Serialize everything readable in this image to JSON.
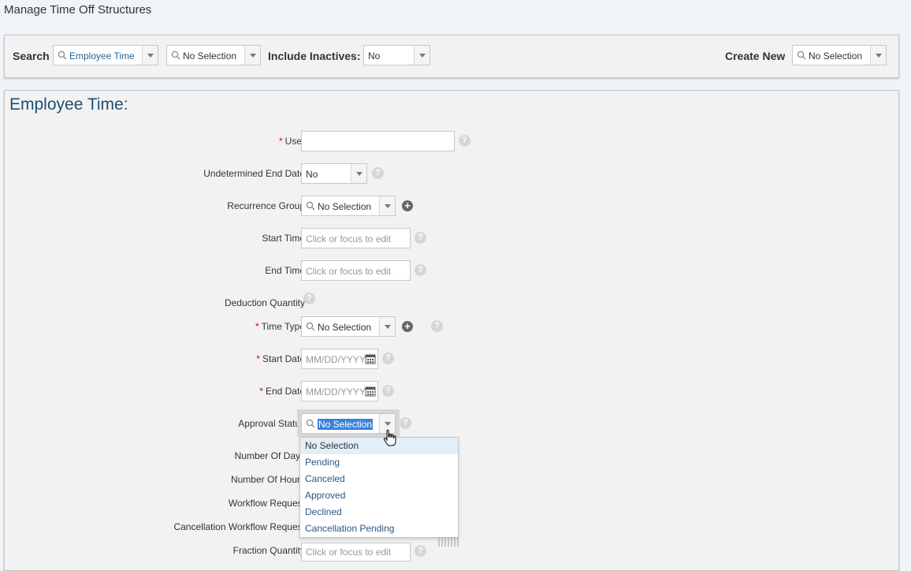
{
  "page": {
    "title": "Manage Time Off Structures"
  },
  "toolbar": {
    "search_label": "Search",
    "search_type": "Employee Time",
    "search_value": "No Selection",
    "include_inactives_label": "Include Inactives:",
    "include_inactives_value": "No",
    "create_new_label": "Create New",
    "create_new_value": "No Selection"
  },
  "form": {
    "title": "Employee Time:",
    "user_label": "User",
    "undetermined_end_date_label": "Undetermined End Date",
    "undetermined_end_date_value": "No",
    "recurrence_group_label": "Recurrence Group",
    "recurrence_group_value": "No Selection",
    "start_time_label": "Start Time",
    "start_time_placeholder": "Click or focus to edit",
    "end_time_label": "End Time",
    "end_time_placeholder": "Click or focus to edit",
    "deduction_quantity_label": "Deduction Quantity",
    "time_type_label": "Time Type",
    "time_type_value": "No Selection",
    "start_date_label": "Start Date",
    "start_date_placeholder": "MM/DD/YYYY",
    "end_date_label": "End Date",
    "end_date_placeholder": "MM/DD/YYYY",
    "approval_status_label": "Approval Status",
    "approval_status_value": "No Selection",
    "number_of_days_label": "Number Of Days",
    "number_of_hours_label": "Number Of Hours",
    "workflow_request_label": "Workflow Request",
    "cancellation_workflow_request_label": "Cancellation Workflow Request",
    "fraction_quantity_label": "Fraction Quantity",
    "fraction_quantity_placeholder": "Click or focus to edit",
    "required_marker": "*",
    "help_glyph": "?",
    "plus_glyph": "+"
  },
  "approval_dropdown": {
    "options": [
      "No Selection",
      "Pending",
      "Canceled",
      "Approved",
      "Declined",
      "Cancellation Pending"
    ]
  },
  "colors": {
    "accent": "#1d4f72",
    "required": "#d9001b",
    "selection": "#3a82d8",
    "link": "#2a5785"
  }
}
